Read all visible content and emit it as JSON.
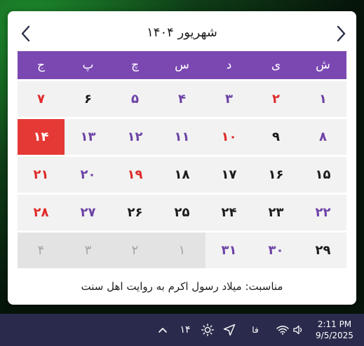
{
  "calendar": {
    "title": "شهریور ۱۴۰۴",
    "weekdays": [
      "ش",
      "ی",
      "د",
      "س",
      "چ",
      "پ",
      "ج"
    ],
    "weeks": [
      [
        {
          "d": "۱",
          "c": "purple"
        },
        {
          "d": "۲",
          "c": "red"
        },
        {
          "d": "۳",
          "c": "purple"
        },
        {
          "d": "۴",
          "c": "purple"
        },
        {
          "d": "۵",
          "c": "purple"
        },
        {
          "d": "۶",
          "c": "black"
        },
        {
          "d": "۷",
          "c": "red"
        }
      ],
      [
        {
          "d": "۸",
          "c": "purple"
        },
        {
          "d": "۹",
          "c": "black"
        },
        {
          "d": "۱۰",
          "c": "red"
        },
        {
          "d": "۱۱",
          "c": "purple"
        },
        {
          "d": "۱۲",
          "c": "purple"
        },
        {
          "d": "۱۳",
          "c": "purple"
        },
        {
          "d": "۱۴",
          "c": "today"
        }
      ],
      [
        {
          "d": "۱۵",
          "c": "black"
        },
        {
          "d": "۱۶",
          "c": "black"
        },
        {
          "d": "۱۷",
          "c": "black"
        },
        {
          "d": "۱۸",
          "c": "black"
        },
        {
          "d": "۱۹",
          "c": "red"
        },
        {
          "d": "۲۰",
          "c": "purple"
        },
        {
          "d": "۲۱",
          "c": "red"
        }
      ],
      [
        {
          "d": "۲۲",
          "c": "purple"
        },
        {
          "d": "۲۳",
          "c": "black"
        },
        {
          "d": "۲۴",
          "c": "black"
        },
        {
          "d": "۲۵",
          "c": "black"
        },
        {
          "d": "۲۶",
          "c": "black"
        },
        {
          "d": "۲۷",
          "c": "purple"
        },
        {
          "d": "۲۸",
          "c": "red"
        }
      ],
      [
        {
          "d": "۲۹",
          "c": "black"
        },
        {
          "d": "۳۰",
          "c": "purple"
        },
        {
          "d": "۳۱",
          "c": "purple"
        },
        {
          "d": "۱",
          "c": "other"
        },
        {
          "d": "۲",
          "c": "other"
        },
        {
          "d": "۳",
          "c": "other"
        },
        {
          "d": "۴",
          "c": "other"
        }
      ]
    ],
    "occasion": "مناسبت: میلاد رسول اکرم به روایت اهل سنت"
  },
  "taskbar": {
    "tray_day": "۱۴",
    "language": "فا",
    "time": "2:11 PM",
    "date": "9/5/2025"
  },
  "icons": {
    "prev": "chevron-left-icon",
    "next": "chevron-right-icon",
    "tray_overflow": "chevron-up-icon",
    "brightness": "sun-icon",
    "location": "navigation-arrow-icon",
    "network": "wifi-icon",
    "sound": "speaker-icon"
  },
  "colors": {
    "header_bg": "#7b48b2",
    "today_bg": "#e53935",
    "holiday": "#e02a2a",
    "weekday_accent": "#6d43a6",
    "taskbar_bg": "#2a2b4c"
  }
}
